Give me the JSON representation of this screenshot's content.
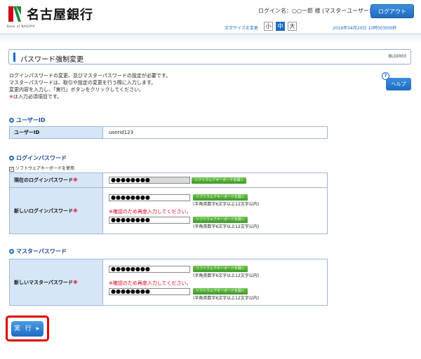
{
  "header": {
    "bank_name": "名古屋銀行",
    "logo_sub": "Bank of NAGOYA",
    "login_name": "ログイン名：○○一郎 様 (マスターユーザー)",
    "logout_label": "ログアウト",
    "fontsize_label": "文字サイズを変更",
    "fontsize_small": "小",
    "fontsize_medium": "中",
    "fontsize_large": "大",
    "datetime": "2016年04月20日 10時00分00秒"
  },
  "page": {
    "title": "パスワード強制変更",
    "screen_id": "BLGI003",
    "intro": [
      "ログインパスワードの変更、及びマスターパスワードの設定が必要です。",
      "マスターパスワードは、取引や設定の変更を行う際に入力します。",
      "変更内容を入力し、「実行」ボタンをクリックしてください。"
    ],
    "required_mark": "※",
    "required_note": "は入力必須項目です。",
    "help_label": "ヘルプ",
    "help_q": "?"
  },
  "user_section": {
    "heading": "ユーザーID",
    "label": "ユーザーID",
    "value": "userid123"
  },
  "login_section": {
    "heading": "ログインパスワード",
    "sw_keyboard_check": "ソフトウェアキーボードを使用",
    "current_label": "現在のログインパスワード",
    "new_label": "新しいログインパスワード",
    "masked": "●●●●●●●●",
    "kb_button": "ソフトウェアキーボードを開く",
    "hint": "(半角英数字6文字以上12文字以内)",
    "confirm_note": "※確認のため再度入力してください。"
  },
  "master_section": {
    "heading": "マスターパスワード",
    "new_label": "新しいマスターパスワード",
    "masked": "●●●●●●●●",
    "kb_button": "ソフトウェアキーボードを開く",
    "hint": "(半角英数字6文字以上12文字以内)",
    "confirm_note": "※確認のため再度入力してください。"
  },
  "actions": {
    "execute_label": "実 行 ▸"
  },
  "colors": {
    "accent": "#1f6cc0",
    "required": "#e0001b",
    "keyboard_button": "#4ca832",
    "highlight_frame": "#e00000"
  }
}
